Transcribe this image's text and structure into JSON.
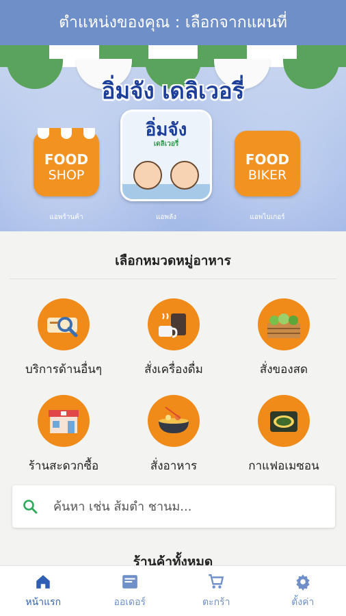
{
  "header": {
    "title": "ตำแหน่งของคุณ : เลือกจากแผนที่"
  },
  "banner": {
    "brand": "อิ่มจัง เดลิเวอรี่",
    "apps": [
      {
        "line1": "FOOD",
        "line2": "SHOP",
        "label": "แอพร้านค้า"
      },
      {
        "title": "อิ่มจัง",
        "subtitle": "เดลิเวอรี่",
        "label": "แอพลัง"
      },
      {
        "line1": "FOOD",
        "line2": "BIKER",
        "label": "แอพไบเกอร์"
      }
    ]
  },
  "categories": {
    "title": "เลือกหมวดหมู่อาหาร",
    "items": [
      {
        "label": "บริการด้านอื่นๆ",
        "icon": "services-icon"
      },
      {
        "label": "สั่งเครื่องดื่ม",
        "icon": "drinks-icon"
      },
      {
        "label": "สั่งของสด",
        "icon": "fresh-produce-icon"
      },
      {
        "label": "ร้านสะดวกซื้อ",
        "icon": "convenience-store-icon"
      },
      {
        "label": "สั่งอาหาร",
        "icon": "food-bowl-icon"
      },
      {
        "label": "กาแฟอเมซอน",
        "icon": "amazon-coffee-icon"
      }
    ]
  },
  "search": {
    "placeholder": "ค้นหา เช่น ส้มตำ ชานม..."
  },
  "stores": {
    "title": "ร้านค้าทั้งหมด"
  },
  "nav": {
    "items": [
      {
        "label": "หน้าแรก",
        "icon": "home-icon"
      },
      {
        "label": "ออเดอร์",
        "icon": "orders-icon"
      },
      {
        "label": "ตะกร้า",
        "icon": "cart-icon"
      },
      {
        "label": "ตั้งค่า",
        "icon": "gear-icon"
      }
    ]
  },
  "colors": {
    "header": "#6f8fc9",
    "accent": "#f08a19",
    "nav_active": "#2f5fb5"
  }
}
